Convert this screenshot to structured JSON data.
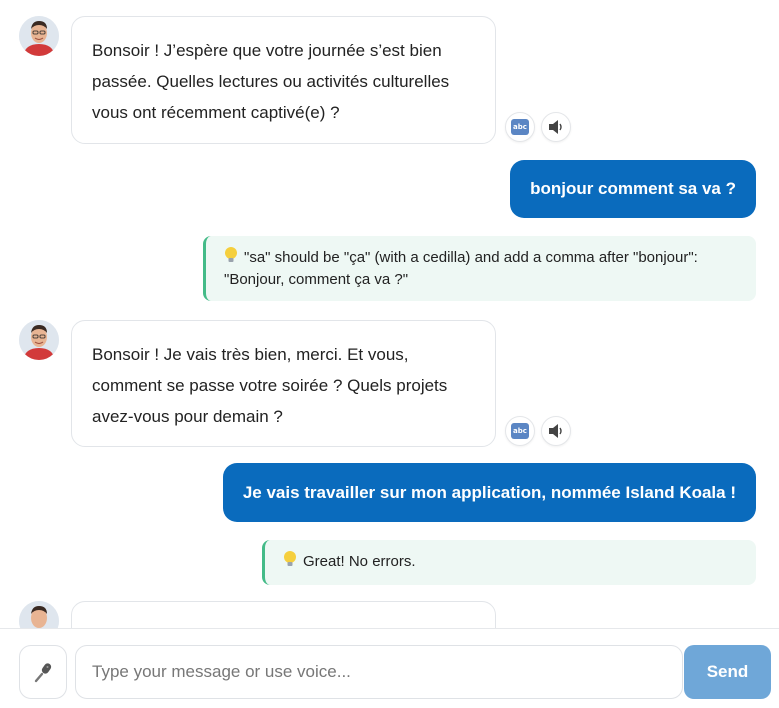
{
  "messages": [
    {
      "role": "bot",
      "text": "Bonsoir ! J’espère que votre journée s’est bien passée. Quelles lectures ou activités culturelles vous ont récemment captivé(e) ?",
      "tools": [
        "abc-icon",
        "speaker-icon"
      ]
    },
    {
      "role": "user",
      "text": "bonjour comment sa va ?",
      "feedback": "\"sa\" should be \"ça\" (with a cedilla) and add a comma after \"bonjour\": \"Bonjour, comment ça va ?\""
    },
    {
      "role": "bot",
      "text": "Bonsoir ! Je vais très bien, merci. Et vous, comment se passe votre soirée ? Quels projets avez-vous pour demain ?",
      "tools": [
        "abc-icon",
        "speaker-icon"
      ]
    },
    {
      "role": "user",
      "text": "Je vais travailler sur mon application, nommée Island Koala !",
      "feedback": "Great! No errors."
    },
    {
      "role": "bot",
      "text": "",
      "partial": true
    }
  ],
  "input": {
    "placeholder": "Type your message or use voice...",
    "value": ""
  },
  "controls": {
    "mic_icon": "microphone-icon",
    "send_label": "Send"
  },
  "colors": {
    "user_bubble": "#0a6bbd",
    "feedback_bg": "#eef8f4",
    "feedback_border": "#44bb88",
    "send_button": "#6fa7d8"
  }
}
